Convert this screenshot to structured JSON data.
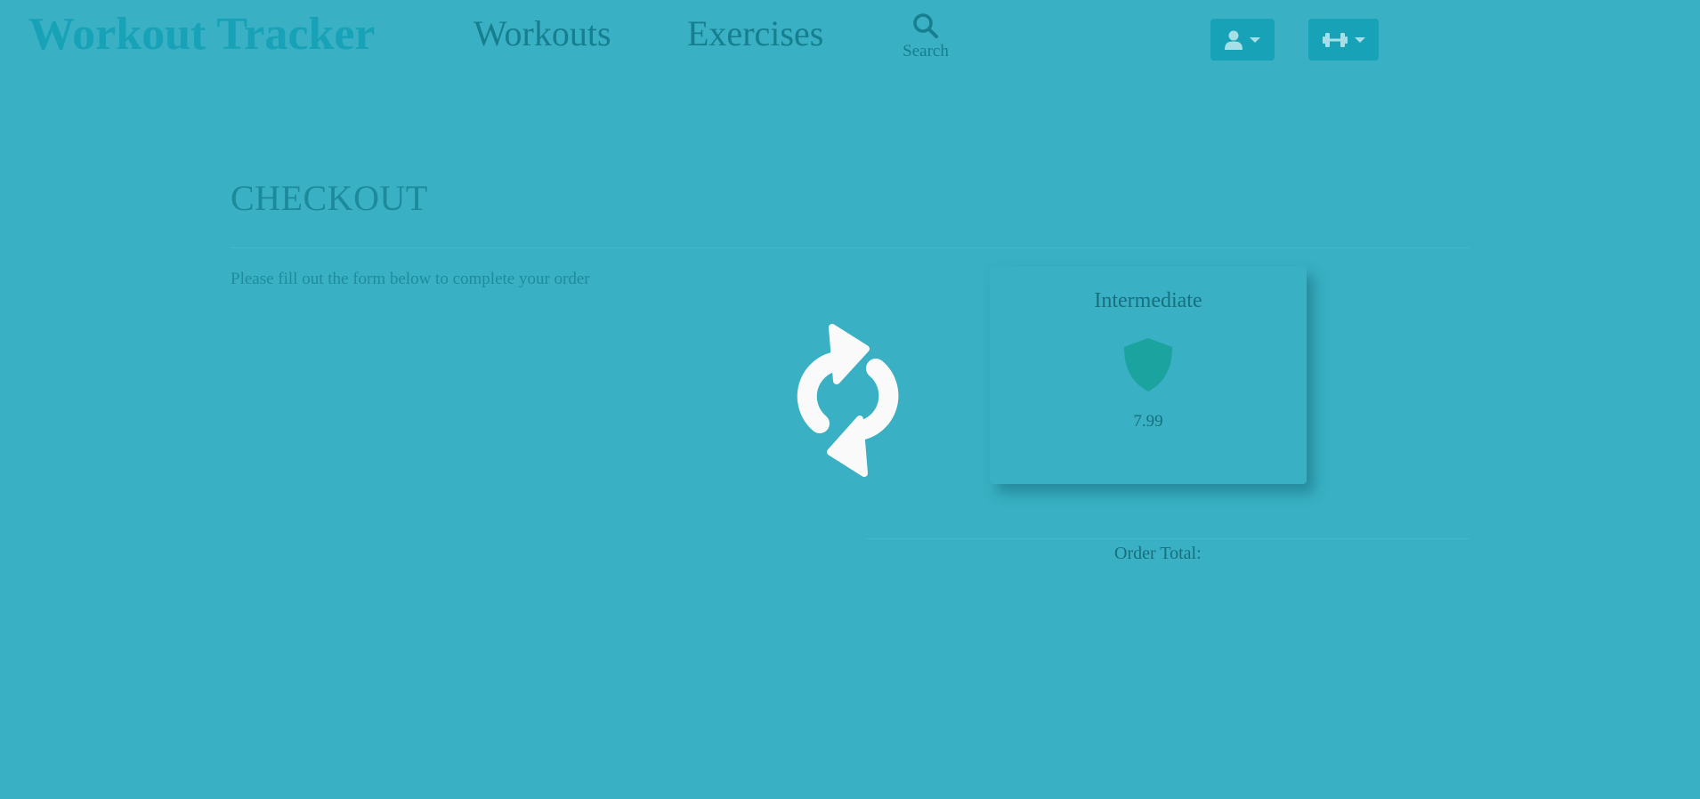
{
  "header": {
    "brand": "Workout Tracker",
    "nav": {
      "workouts": "Workouts",
      "exercises": "Exercises"
    },
    "search": {
      "label": "Search",
      "icon": "search-icon"
    },
    "dropdowns": [
      {
        "icon": "user-icon"
      },
      {
        "icon": "dumbbell-icon"
      }
    ]
  },
  "checkout": {
    "title": "CHECKOUT",
    "intro": "Please fill out the form below to complete your order",
    "plan": {
      "name": "Intermediate",
      "icon": "shield-icon",
      "price": "7.99"
    },
    "order_total_label": "Order Total:"
  },
  "overlay": {
    "icon": "sync-spinner-icon"
  },
  "colors": {
    "background": "#39b0c3",
    "brand": "#17a2b8",
    "shield": "#1aa39f",
    "spinner": "#fafafa"
  }
}
